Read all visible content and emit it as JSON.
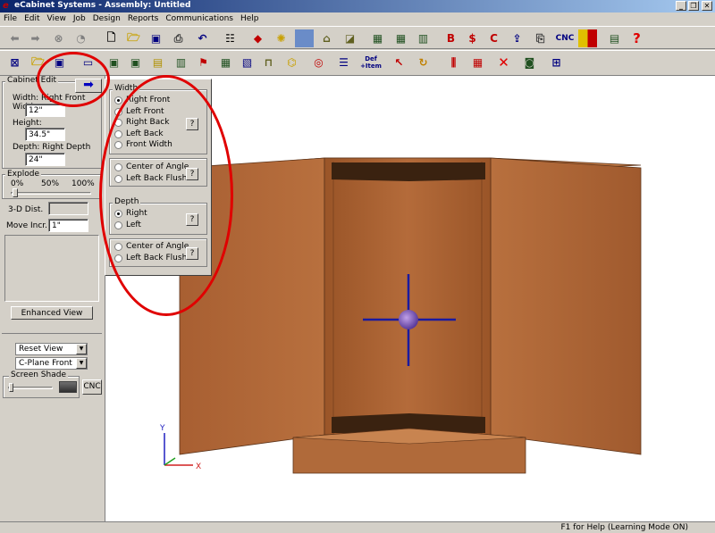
{
  "window": {
    "title": "eCabinet Systems - Assembly: Untitled",
    "logo_text": "e",
    "controls": [
      "_",
      "❐",
      "✕"
    ]
  },
  "menu": [
    "File",
    "Edit",
    "View",
    "Job",
    "Design",
    "Reports",
    "Communications",
    "Help"
  ],
  "toolbar_icons": {
    "row1": [
      "back-arrow",
      "forward-arrow",
      "stop",
      "refresh",
      "new-doc",
      "open-folder",
      "save",
      "print",
      "undo",
      "settings",
      "material",
      "light",
      "texture",
      "hardware",
      "hardware2",
      "cabinet",
      "cabinet2",
      "cabinet3",
      "report-b",
      "report-dollar",
      "report-c",
      "export",
      "export2",
      "cnc",
      "grid",
      "screen",
      "help"
    ],
    "cnc_label": "CNC",
    "help_glyph": "?"
  },
  "toolbar2": {
    "def_item_label": "Def\n+Item"
  },
  "left_panel": {
    "group_title": "Cabinet Edit",
    "width_label": "Width: Right Front Width",
    "width_value": "12\"",
    "height_label": "Height:",
    "height_value": "34.5\"",
    "depth_label": "Depth: Right Depth",
    "depth_value": "24\"",
    "explode_label": "Explode",
    "explode_ticks": [
      "0%",
      "50%",
      "100%"
    ],
    "dist_label": "3-D Dist.",
    "move_label": "Move Incr.",
    "move_value": "1\"",
    "enhanced_view_label": "Enhanced View",
    "reset_view": "Reset View",
    "cplane": "C-Plane Front",
    "screen_shade_label": "Screen Shade",
    "cnc_button": "CNC"
  },
  "flyout": {
    "width_title": "Width",
    "width_options": [
      {
        "label": "Right Front",
        "selected": true
      },
      {
        "label": "Left Front",
        "selected": false
      },
      {
        "label": "Right Back",
        "selected": false
      },
      {
        "label": "Left Back",
        "selected": false
      },
      {
        "label": "Front Width",
        "selected": false
      }
    ],
    "width_options2": [
      {
        "label": "Center of Angle",
        "selected": false
      },
      {
        "label": "Left Back Flush",
        "selected": false
      }
    ],
    "depth_title": "Depth",
    "depth_options": [
      {
        "label": "Right",
        "selected": true
      },
      {
        "label": "Left",
        "selected": false
      }
    ],
    "depth_options2": [
      {
        "label": "Center of Angle",
        "selected": false
      },
      {
        "label": "Left Back Flush",
        "selected": false
      }
    ],
    "help_glyph": "?"
  },
  "axes": {
    "x": "X",
    "y": "Y"
  },
  "status": "F1 for Help (Learning Mode ON)",
  "colors": {
    "wood": "#b06a3a",
    "wood_dark": "#8a4e27",
    "annotation": "#e00000",
    "gizmo": "#1a1aa0"
  }
}
